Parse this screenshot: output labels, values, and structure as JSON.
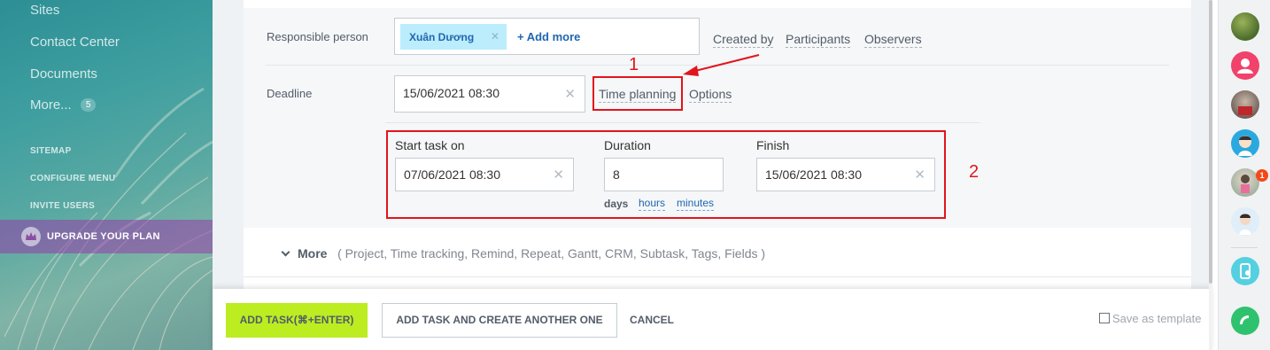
{
  "sidebar": {
    "items": [
      {
        "label": "Sites"
      },
      {
        "label": "Contact Center"
      },
      {
        "label": "Documents"
      },
      {
        "label": "More..."
      }
    ],
    "more_count": "5",
    "small_links": [
      "SITEMAP",
      "CONFIGURE MENU",
      "INVITE USERS"
    ],
    "upgrade_label": "UPGRADE YOUR PLAN"
  },
  "task_form": {
    "responsible_label": "Responsible person",
    "responsible_chip": "Xuân Dương",
    "add_more": "+ Add more",
    "role_links": [
      "Created by",
      "Participants",
      "Observers"
    ],
    "deadline_label": "Deadline",
    "deadline_value": "15/06/2021 08:30",
    "time_planning": "Time planning",
    "options": "Options",
    "planning": {
      "start_label": "Start task on",
      "start_value": "07/06/2021 08:30",
      "duration_label": "Duration",
      "duration_value": "8",
      "finish_label": "Finish",
      "finish_value": "15/06/2021 08:30",
      "unit_selected": "days",
      "units": [
        "hours",
        "minutes"
      ]
    },
    "more_label": "More",
    "more_options": "( Project,  Time tracking,  Remind,  Repeat,  Gantt,  CRM,  Subtask,  Tags,  Fields )"
  },
  "annotations": {
    "one": "1",
    "two": "2"
  },
  "footer": {
    "add_task": "ADD TASK(⌘+ENTER)",
    "add_another": "ADD TASK AND CREATE ANOTHER ONE",
    "cancel": "CANCEL",
    "save_template": "Save as template"
  },
  "right_rail": {
    "badge_count": "1",
    "icons": [
      "avatar-nature",
      "user-profile-icon",
      "avatar-person",
      "avatar-cartoon",
      "avatar-photo",
      "avatar-girl",
      "mobile-share-icon",
      "phone-icon"
    ]
  },
  "colors": {
    "accent_green": "#bbed21",
    "link_blue": "#2067b0",
    "annotation_red": "#e2141c",
    "chip_bg": "#bcedfc"
  }
}
